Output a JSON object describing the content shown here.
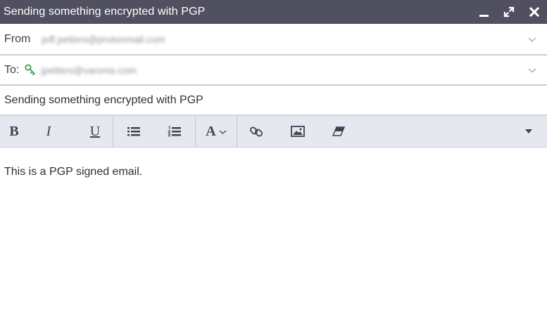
{
  "window": {
    "title": "Sending something encrypted with PGP",
    "controls": [
      "minimize-icon",
      "expand-icon",
      "close-icon"
    ],
    "titlebar_color": "#505061"
  },
  "from": {
    "label": "From",
    "value": "jeff.petters@protonmail.com"
  },
  "to": {
    "label": "To:",
    "recipient": "jpetters@varonis.com",
    "recipient_icon": "key-icon",
    "key_color": "#3aa04a"
  },
  "subject": {
    "value": "Sending something encrypted with PGP"
  },
  "toolbar": {
    "bold_label": "B",
    "italic_label": "I",
    "underline_label": "U",
    "font_label": "A",
    "icons": [
      "unordered-list-icon",
      "ordered-list-icon",
      "link-icon",
      "image-icon",
      "eraser-icon",
      "more-options-icon"
    ]
  },
  "body": {
    "text": "This is a PGP signed email."
  }
}
